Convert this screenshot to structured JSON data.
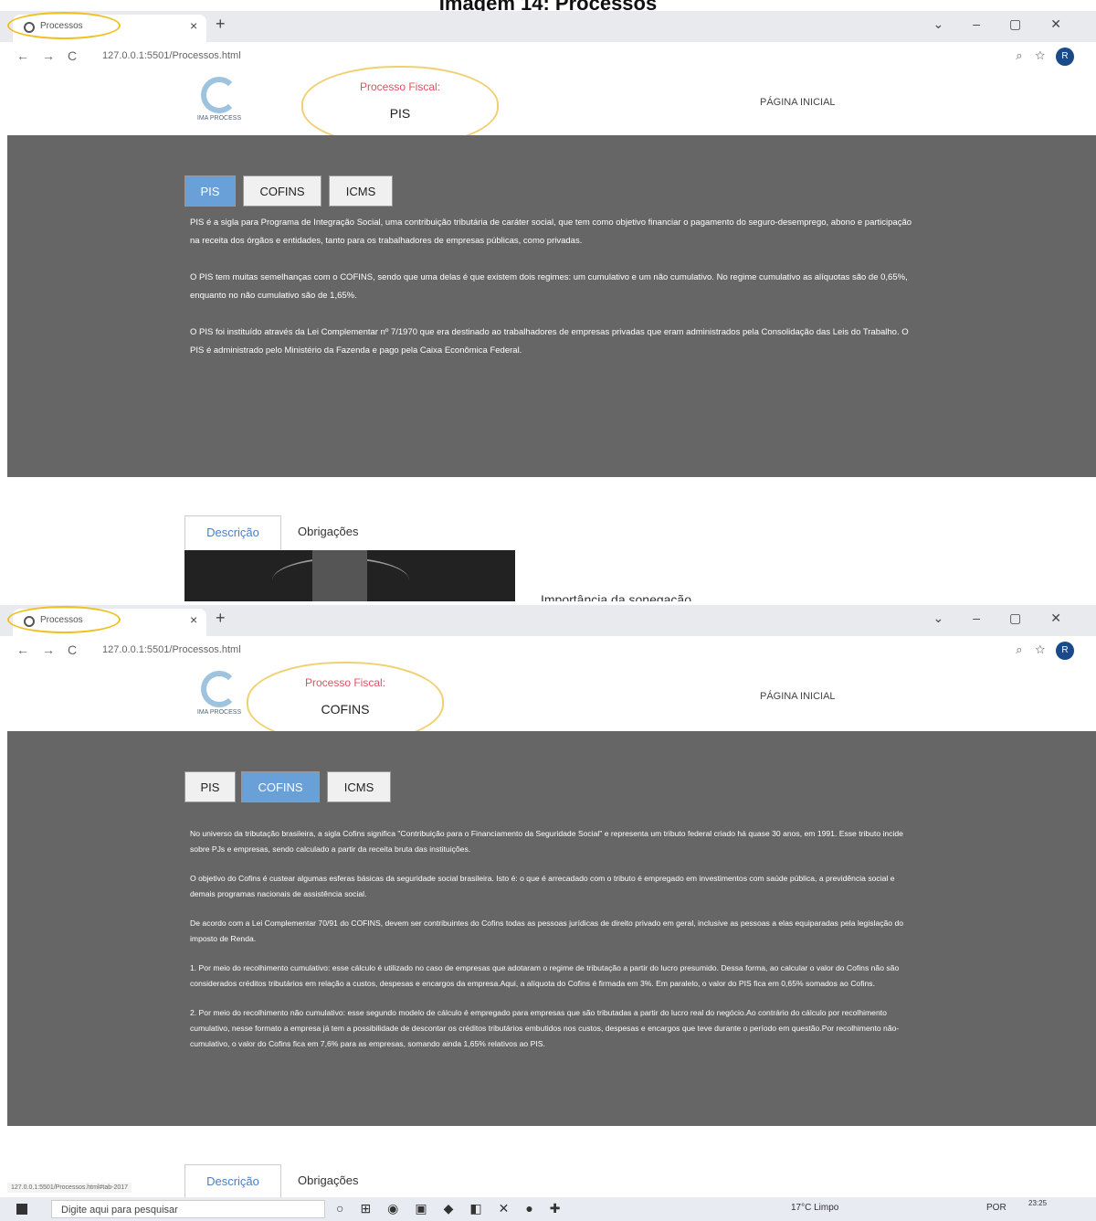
{
  "caption": "Imagem 14: Processos",
  "screens": [
    {
      "tab_title": "Processos",
      "url": "127.0.0.1:5501/Processos.html",
      "logo_text": "IMA PROCESS",
      "nav_link": "PÁGINA INICIAL",
      "cloud_title": "Processo Fiscal:",
      "cloud_value": "PIS",
      "tabs": [
        "PIS",
        "COFINS",
        "ICMS"
      ],
      "active_tab": "PIS",
      "paragraphs": [
        "PIS é a sigla para Programa de Integração Social, uma contribuição tributária de caráter social, que tem como objetivo financiar o pagamento do seguro-desemprego, abono e participação na receita dos órgãos e entidades, tanto para os trabalhadores de empresas públicas, como privadas.",
        "O PIS tem muitas semelhanças com o COFINS, sendo que uma delas é que existem dois regimes: um cumulativo e um não cumulativo. No regime cumulativo as alíquotas são de 0,65%, enquanto no não cumulativo são de 1,65%.",
        "O PIS foi instituído através da Lei Complementar nº 7/1970 que era destinado ao trabalhadores de empresas privadas que eram administrados pela Consolidação das Leis do Trabalho. O PIS é administrado pelo Ministério da Fazenda e pago pela Caixa Econômica Federal."
      ],
      "subtabs": [
        "Descrição",
        "Obrigações"
      ],
      "cutoff_heading": "Importância da sonegação"
    },
    {
      "tab_title": "Processos",
      "url": "127.0.0.1:5501/Processos.html",
      "logo_text": "IMA PROCESS",
      "nav_link": "PÁGINA INICIAL",
      "cloud_title": "Processo Fiscal:",
      "cloud_value": "COFINS",
      "tabs": [
        "PIS",
        "COFINS",
        "ICMS"
      ],
      "active_tab": "COFINS",
      "paragraphs": [
        "No universo da tributação brasileira, a sigla Cofins significa \"Contribuição para o Financiamento da Seguridade Social\" e representa um tributo federal criado há quase 30 anos, em 1991. Esse tributo incide sobre PJs e empresas, sendo calculado a partir da receita bruta das instituições.",
        "O objetivo do Cofins é custear algumas esferas básicas da seguridade social brasileira. Isto é: o que é arrecadado com o tributo é empregado em investimentos com saúde pública, a previdência social e demais programas nacionais de assistência social.",
        "De acordo com a Lei Complementar 70/91 do COFINS, devem ser contribuintes do Cofins todas as pessoas jurídicas de direito privado em geral, inclusive as pessoas a elas equiparadas pela legislação do imposto de Renda.",
        "1. Por meio do recolhimento cumulativo: esse cálculo é utilizado no caso de empresas que adotaram o regime de tributação a partir do lucro presumido. Dessa forma, ao calcular o valor do Cofins não são considerados créditos tributários em relação a custos, despesas e encargos da empresa.Aqui, a alíquota do Cofins é firmada em 3%. Em paralelo, o valor do PIS fica em 0,65% somados ao Cofins.",
        "2. Por meio do recolhimento não cumulativo: esse segundo modelo de cálculo é empregado para empresas que são tributadas a partir do lucro real do negócio.Ao contrário do cálculo por recolhimento cumulativo, nesse formato a empresa já tem a possibilidade de descontar os créditos tributários embutidos nos custos, despesas e encargos que teve durante o período em questão.Por recolhimento não-cumulativo, o valor do Cofins fica em 7,6% para as empresas, somando ainda 1,65% relativos ao PIS."
      ],
      "subtabs": [
        "Descrição",
        "Obrigações"
      ],
      "status_url": "127.0.0.1:5501/Processos.html#tab-2017"
    }
  ],
  "taskbar": {
    "search_placeholder": "Digite aqui para pesquisar",
    "weather": "17°C Limpo",
    "lang": "POR",
    "time": "23:25"
  }
}
